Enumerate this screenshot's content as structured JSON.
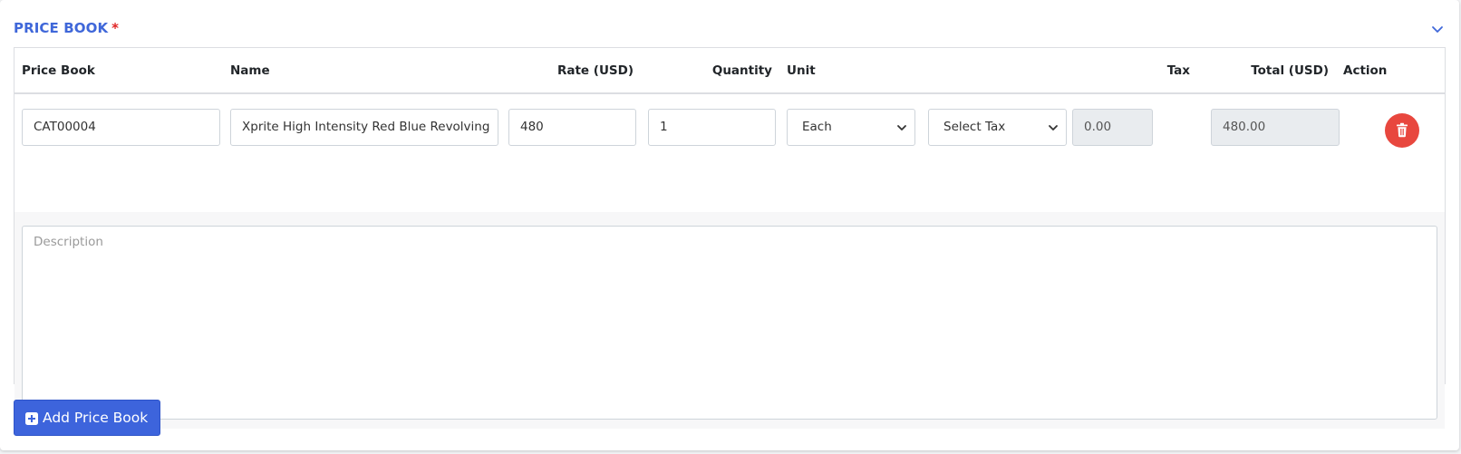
{
  "section": {
    "title": "PRICE BOOK",
    "required_mark": "*"
  },
  "table": {
    "headers": {
      "price_book": "Price Book",
      "name": "Name",
      "rate": "Rate (USD)",
      "quantity": "Quantity",
      "unit": "Unit",
      "tax": "Tax",
      "total": "Total (USD)",
      "action": "Action"
    },
    "row": {
      "price_book_code": "CAT00004",
      "name": "Xprite High Intensity Red Blue Revolving",
      "rate": "480",
      "quantity": "1",
      "unit": "Each",
      "tax_select": "Select Tax",
      "tax_amount": "0.00",
      "total": "480.00"
    },
    "description_placeholder": "Description"
  },
  "add_button_label": "Add Price Book",
  "icons": {
    "collapse": "chevron-down-icon",
    "delete": "trash-icon",
    "add": "plus-square-icon"
  },
  "colors": {
    "accent": "#3f67d9",
    "required": "#e02424",
    "delete": "#e8473e",
    "primary_button": "#3d64dc"
  }
}
